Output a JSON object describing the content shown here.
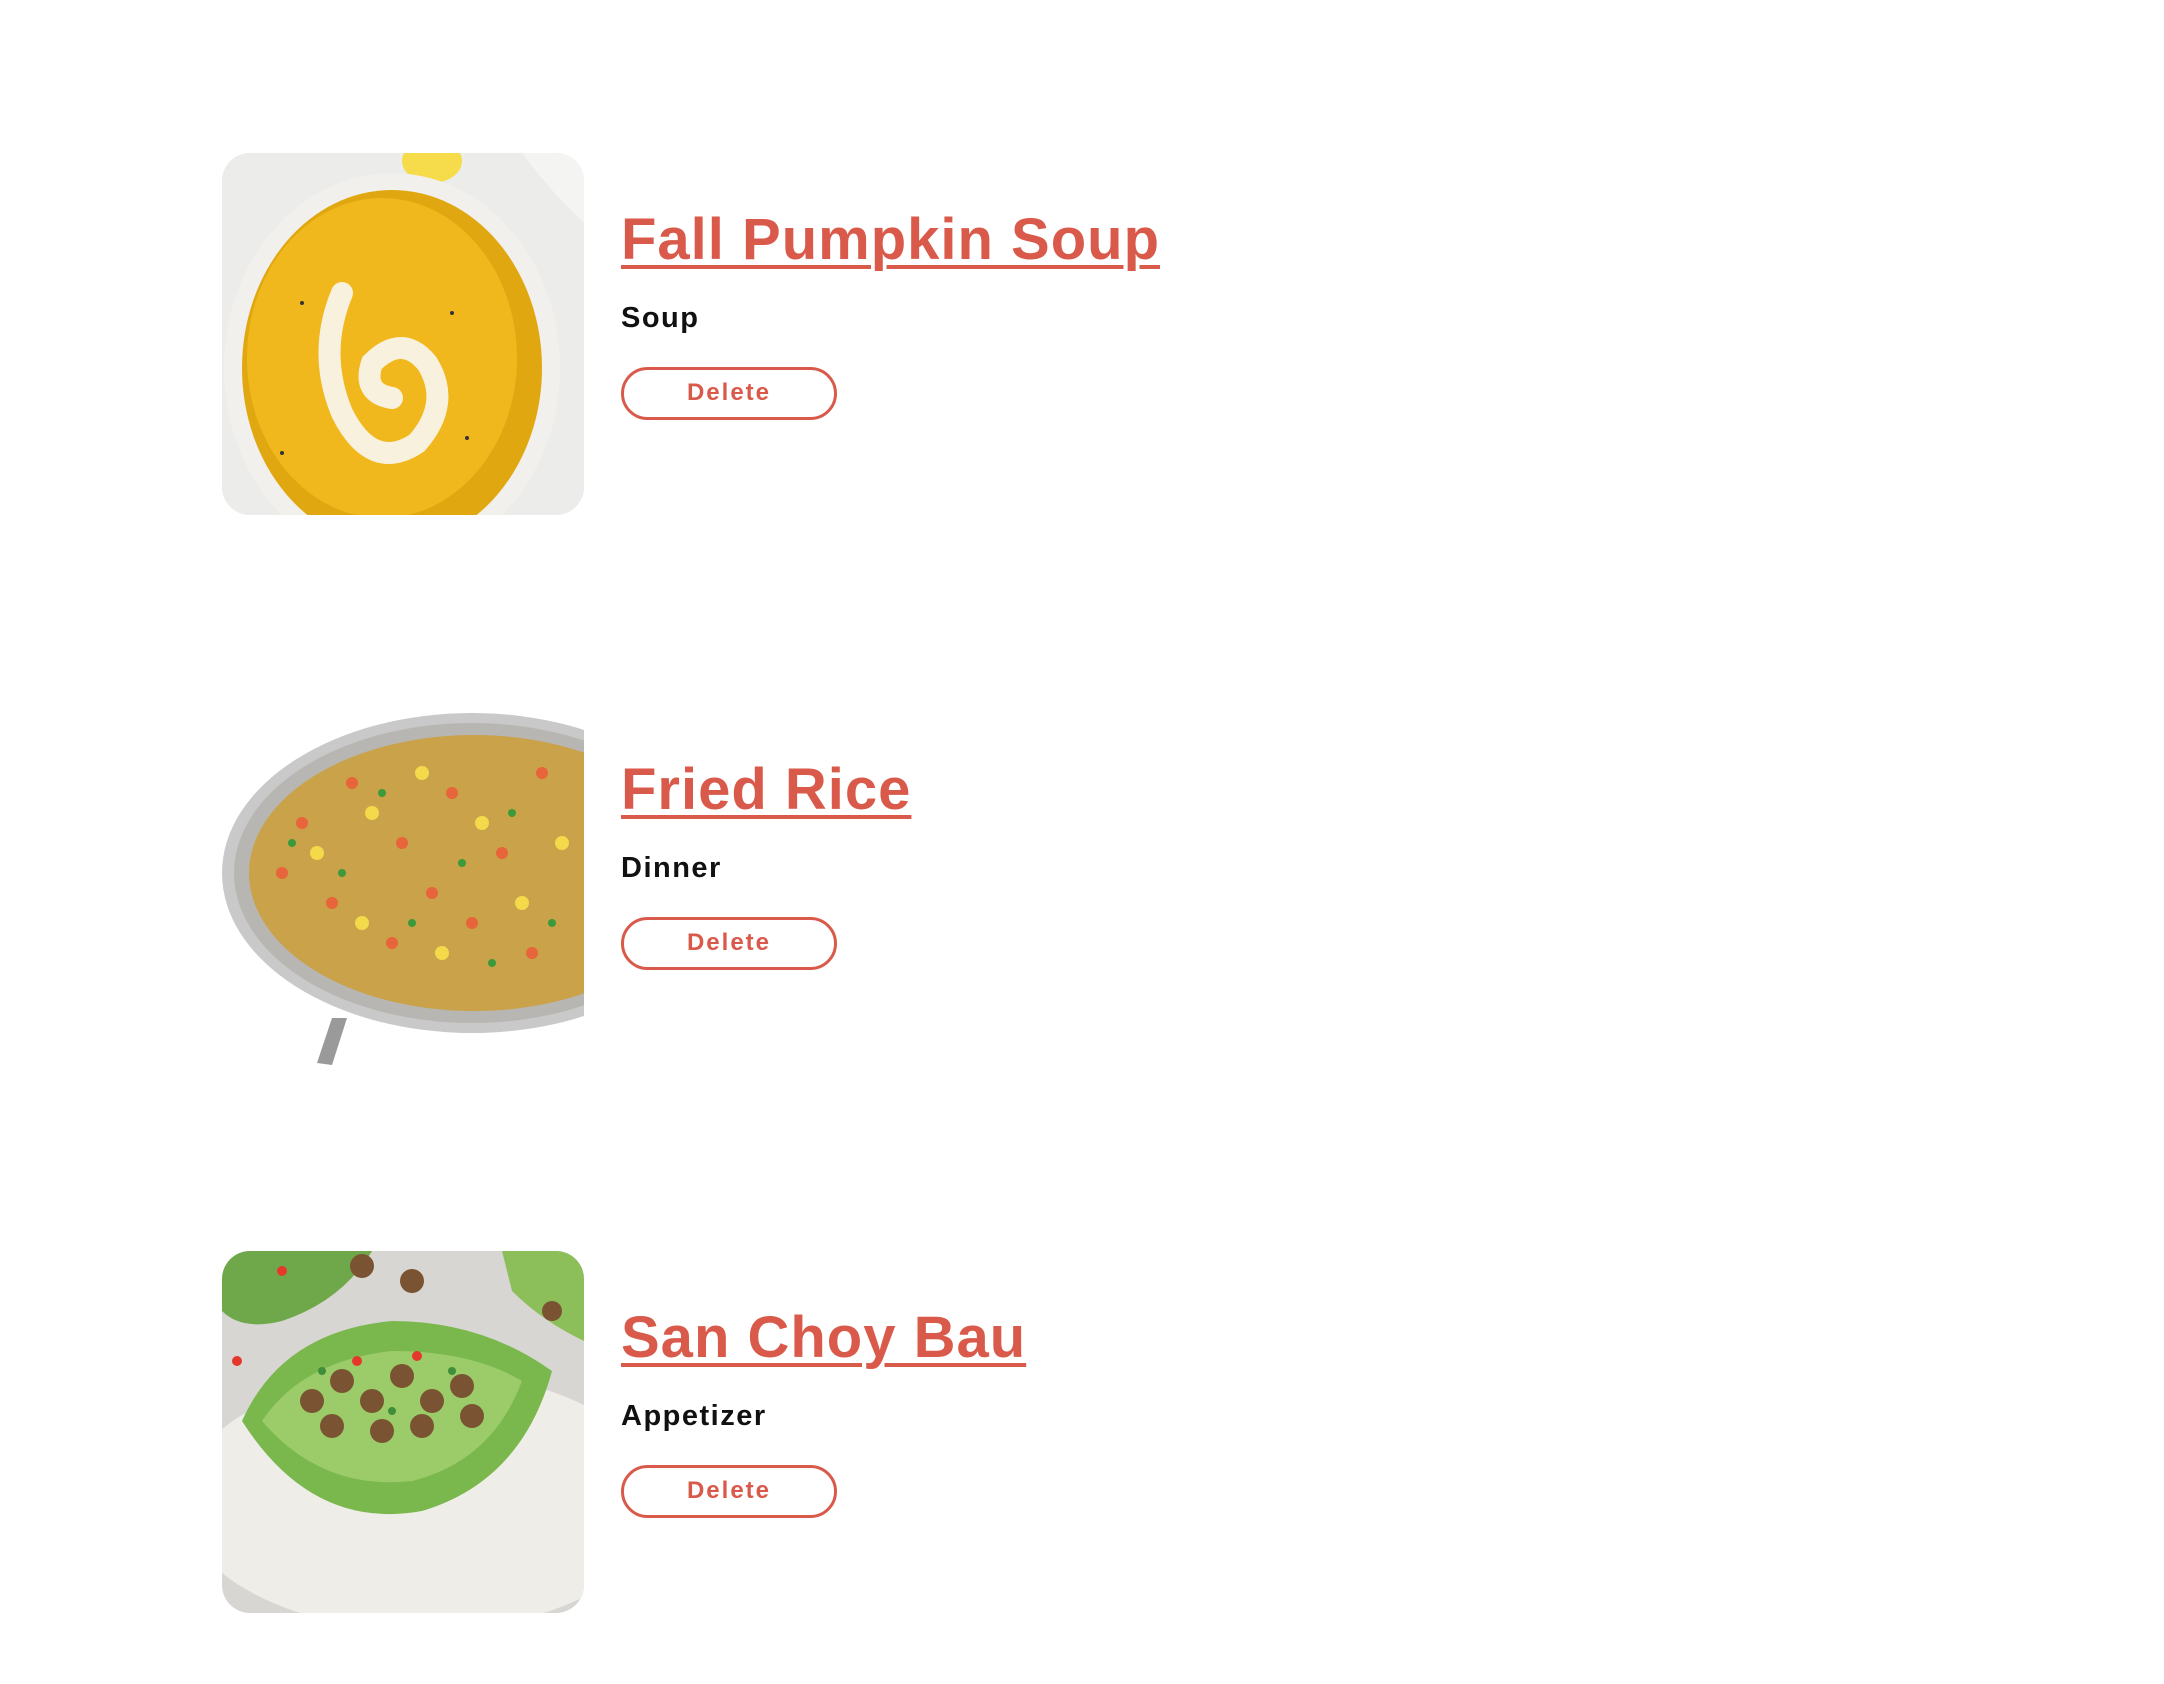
{
  "recipes": [
    {
      "title": "Fall Pumpkin Soup",
      "category": "Soup",
      "delete_label": "Delete",
      "image": "pumpkin-soup-bowl"
    },
    {
      "title": "Fried Rice",
      "category": "Dinner",
      "delete_label": "Delete",
      "image": "fried-rice-pan"
    },
    {
      "title": "San Choy Bau",
      "category": "Appetizer",
      "delete_label": "Delete",
      "image": "lettuce-cups-plate"
    }
  ],
  "colors": {
    "accent": "#d95a4a",
    "text": "#111111",
    "background": "#ffffff"
  }
}
